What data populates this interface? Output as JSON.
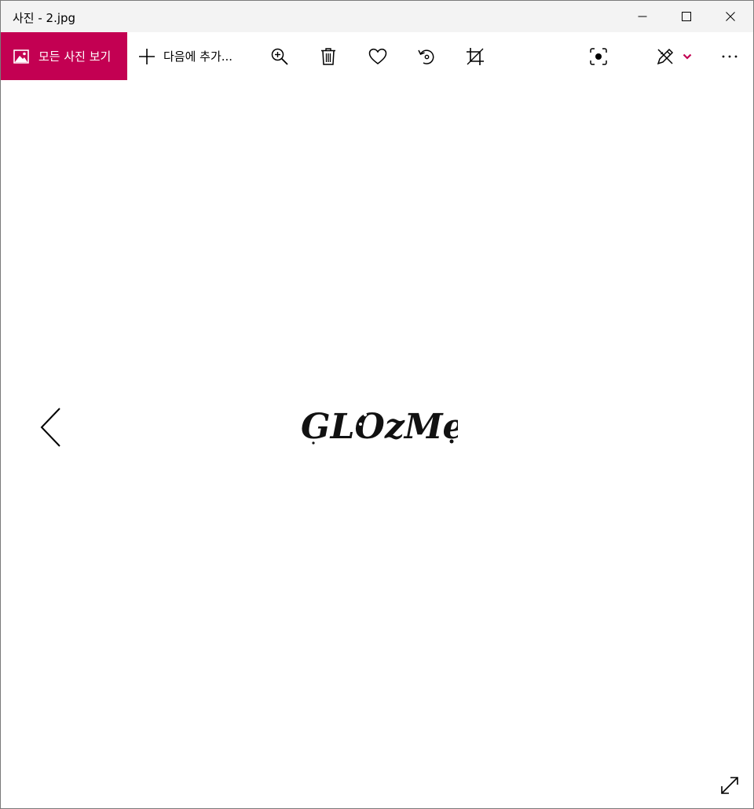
{
  "window": {
    "title": "사진 - 2.jpg",
    "controls": [
      "minimize",
      "maximize",
      "close"
    ]
  },
  "toolbar": {
    "all_photos_label": "모든 사진 보기",
    "add_to_label": "다음에 추가...",
    "icons": [
      "zoom-in-icon",
      "delete-icon",
      "favorite-icon",
      "rotate-icon",
      "crop-icon",
      "visual-search-icon",
      "edit-draw-icon",
      "chevron-down-icon",
      "more-icon"
    ]
  },
  "photo": {
    "text": "GLOzMe"
  },
  "colors": {
    "accent": "#c30052",
    "titlebar": "#f3f3f3",
    "background": "#ffffff"
  }
}
